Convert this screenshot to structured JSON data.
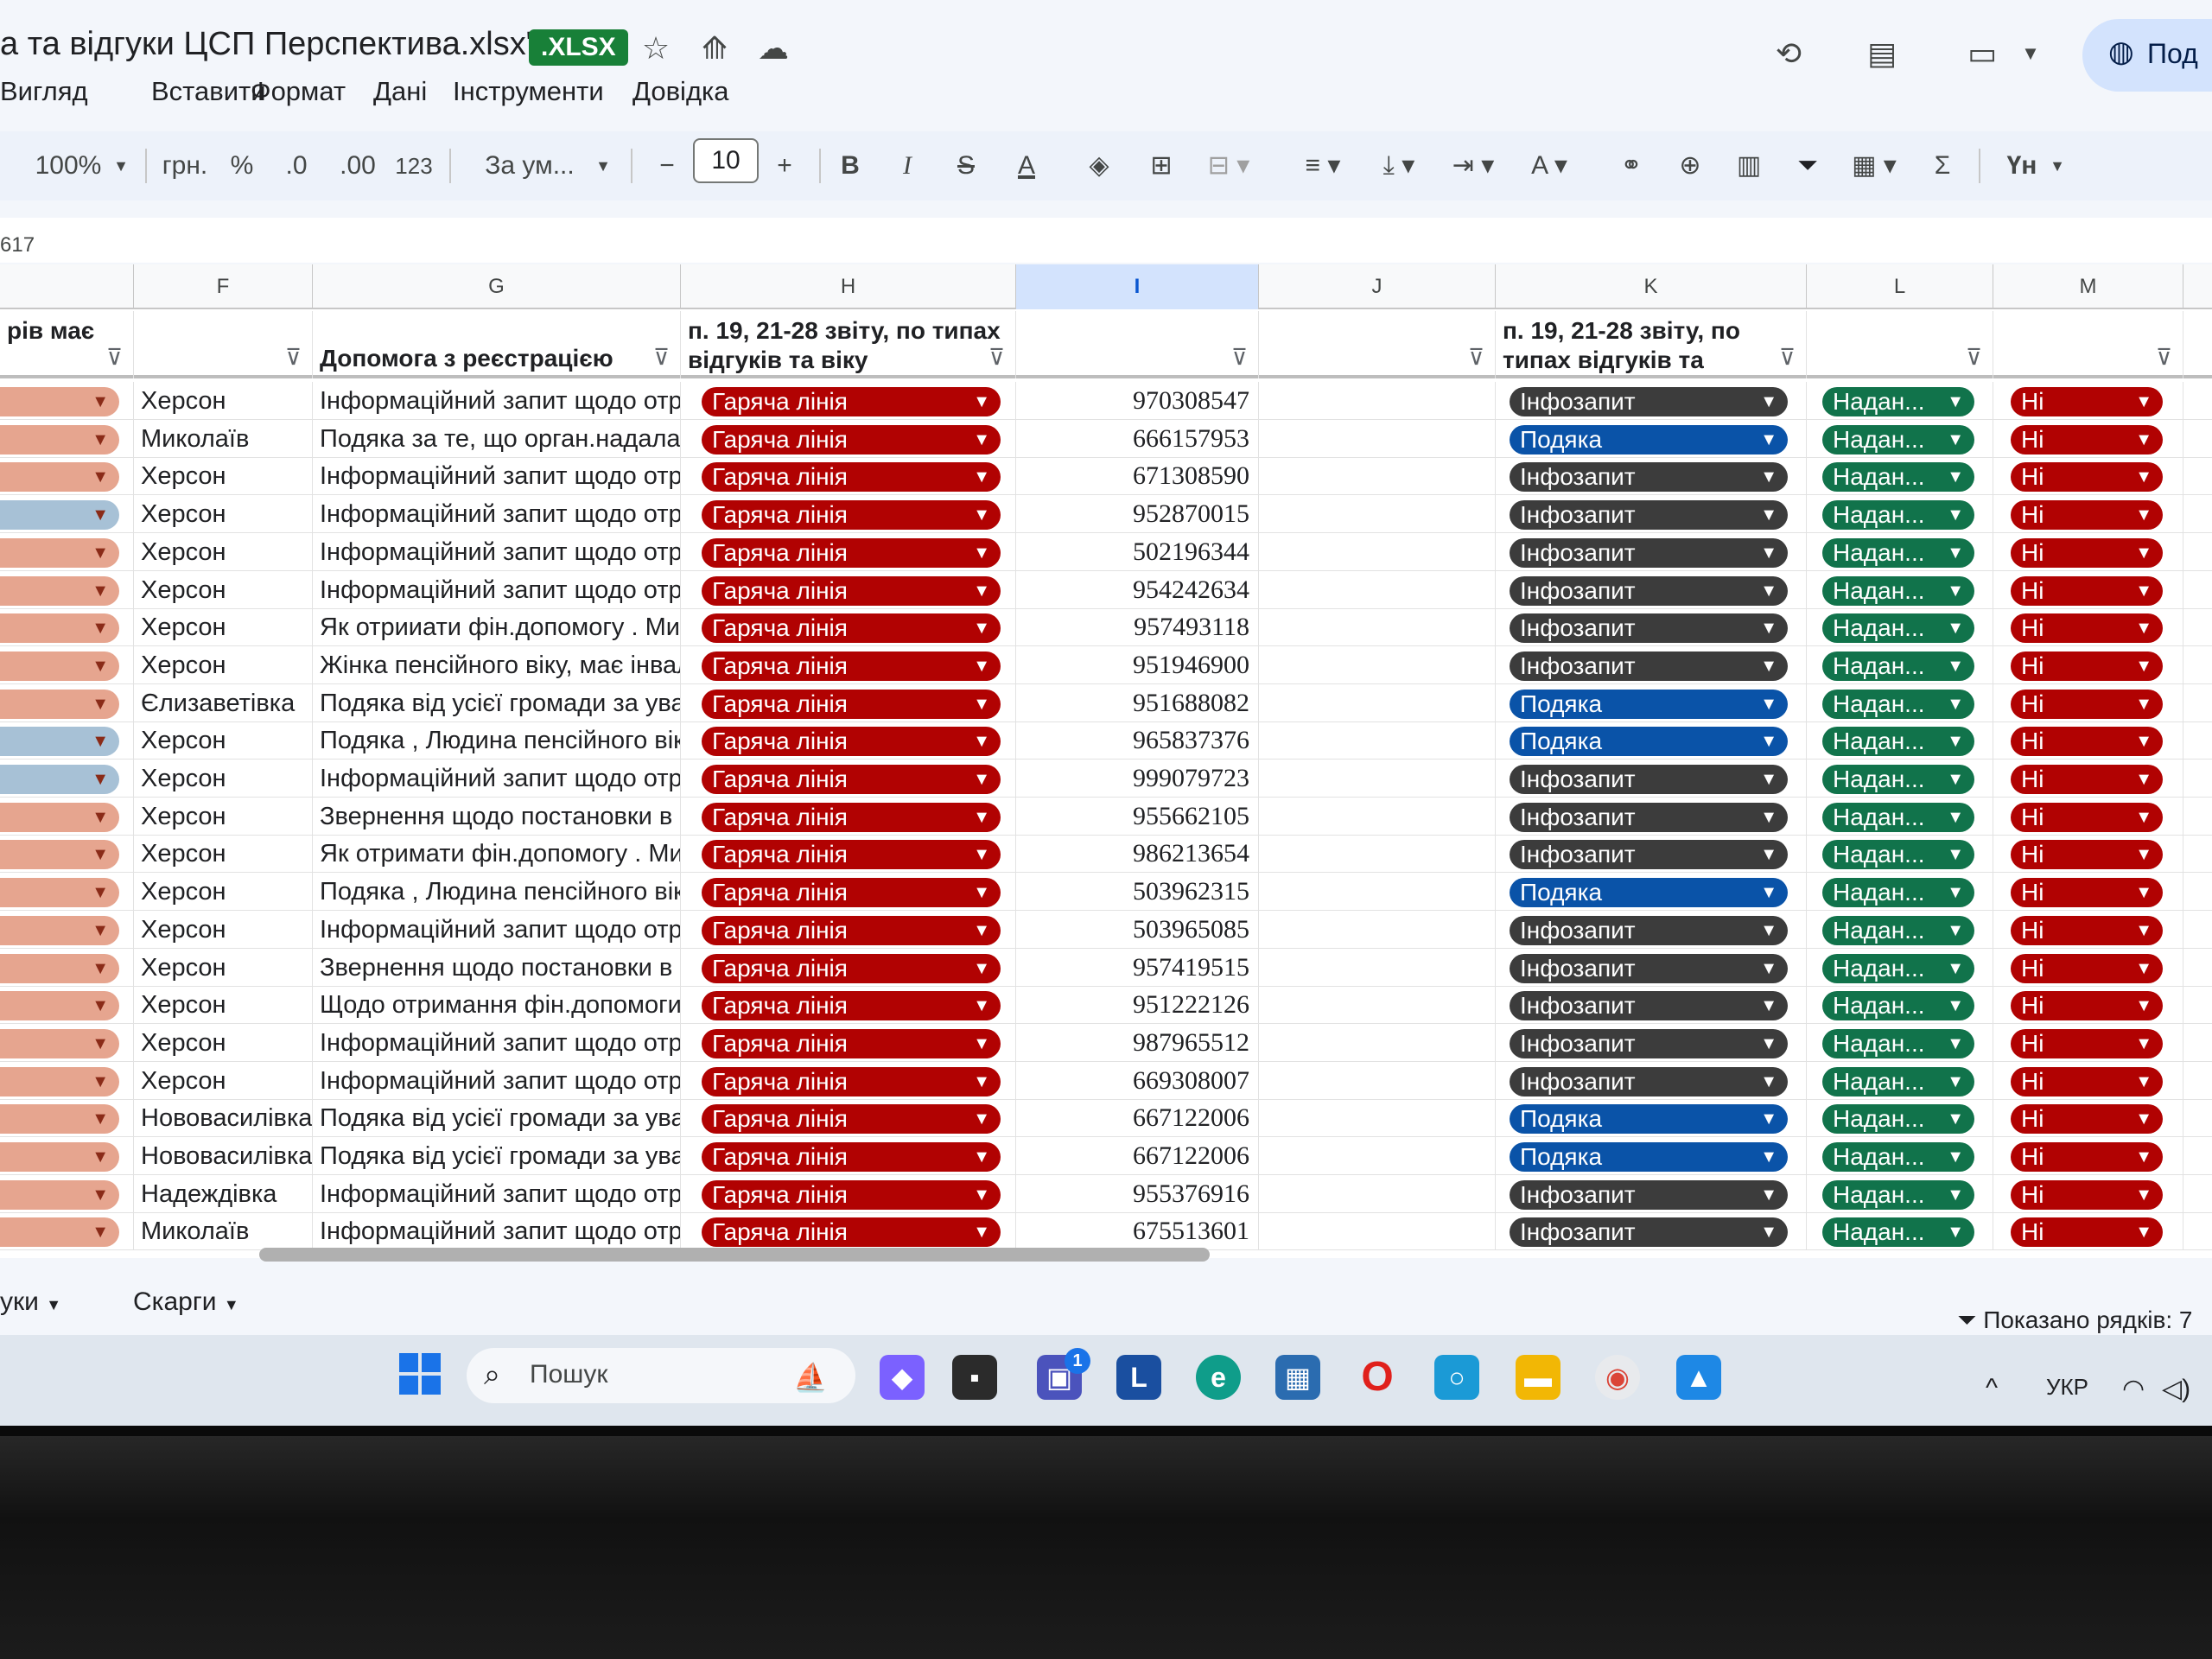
{
  "doc": {
    "title": "а та відгуки ЦСП Перспектива.xlsx\"",
    "badge": ".XLSX",
    "share_label": "Под"
  },
  "menu": [
    "Вигляд",
    "Вставити",
    "Формат",
    "Дані",
    "Інструменти",
    "Довідка"
  ],
  "toolbar": {
    "zoom": "100%",
    "currency": "грн.",
    "percent": "%",
    "dec_dec": ".0",
    "dec_inc": ".00",
    "num_fmt": "123",
    "font": "За ум...",
    "font_size": "10",
    "sigma": "Σ",
    "language": "Үн"
  },
  "cell_ref": "617",
  "columns": [
    "F",
    "G",
    "H",
    "I",
    "J",
    "K",
    "L",
    "M"
  ],
  "headers": {
    "e": "рів має",
    "f": "",
    "g": "Допомога з реєстрацією",
    "h": "п. 19, 21-28 звіту, по типах відгуків та віку",
    "i": "",
    "j": "",
    "k": "п. 19, 21-28 звіту, по типах відгуків та",
    "l": "",
    "m": ""
  },
  "rows": [
    {
      "e": "salmon",
      "f": "Херсон",
      "g": "Інформаційний запит щодо отри",
      "h": "Гаряча лінія",
      "i": "970308547",
      "k": "Інфозапит",
      "l": "Надан...",
      "m": "Ні"
    },
    {
      "e": "salmon",
      "f": "Миколаїв",
      "g": "Подяка за те, що орган.надала д",
      "h": "Гаряча лінія",
      "i": "666157953",
      "k": "Подяка",
      "l": "Надан...",
      "m": "Ні"
    },
    {
      "e": "salmon",
      "f": "Херсон",
      "g": "Інформаційний запит щодо отри",
      "h": "Гаряча лінія",
      "i": "671308590",
      "k": "Інфозапит",
      "l": "Надан...",
      "m": "Ні"
    },
    {
      "e": "steel",
      "f": "Херсон",
      "g": "Інформаційний запит щодо отри",
      "h": "Гаряча лінія",
      "i": "952870015",
      "k": "Інфозапит",
      "l": "Надан...",
      "m": "Ні"
    },
    {
      "e": "salmon",
      "f": "Херсон",
      "g": "Інформаційний запит щодо отри",
      "h": "Гаряча лінія",
      "i": "502196344",
      "k": "Інфозапит",
      "l": "Надан...",
      "m": "Ні"
    },
    {
      "e": "salmon",
      "f": "Херсон",
      "g": "Інформаційний запит щодо отри",
      "h": "Гаряча лінія",
      "i": "954242634",
      "k": "Інфозапит",
      "l": "Надан...",
      "m": "Ні"
    },
    {
      "e": "salmon",
      "f": "Херсон",
      "g": "Як отрииати фін.допомогу . Ми з",
      "h": "Гаряча лінія",
      "i": "957493118",
      "k": "Інфозапит",
      "l": "Надан...",
      "m": "Ні"
    },
    {
      "e": "salmon",
      "f": "Херсон",
      "g": "Жінка пенсійного  віку, має інвалі",
      "h": "Гаряча лінія",
      "i": "951946900",
      "k": "Інфозапит",
      "l": "Надан...",
      "m": "Ні"
    },
    {
      "e": "salmon",
      "f": "Єлизаветівка",
      "g": "Подяка від усієї громади за уваж",
      "h": "Гаряча лінія",
      "i": "951688082",
      "k": "Подяка",
      "l": "Надан...",
      "m": "Ні"
    },
    {
      "e": "steel",
      "f": "Херсон",
      "g": "Подяка , Людина пенсійного віку",
      "h": "Гаряча лінія",
      "i": "965837376",
      "k": "Подяка",
      "l": "Надан...",
      "m": "Ні"
    },
    {
      "e": "steel",
      "f": "Херсон",
      "g": "Інформаційний запит щодо отри",
      "h": "Гаряча лінія",
      "i": "999079723",
      "k": "Інфозапит",
      "l": "Надан...",
      "m": "Ні"
    },
    {
      "e": "salmon",
      "f": "Херсон",
      "g": "Звернення щодо постановки в че",
      "h": "Гаряча лінія",
      "i": "955662105",
      "k": "Інфозапит",
      "l": "Надан...",
      "m": "Ні"
    },
    {
      "e": "salmon",
      "f": "Херсон",
      "g": "Як отримати фін.допомогу . Ми з",
      "h": "Гаряча лінія",
      "i": "986213654",
      "k": "Інфозапит",
      "l": "Надан...",
      "m": "Ні"
    },
    {
      "e": "salmon",
      "f": "Херсон",
      "g": "Подяка , Людина пенсійного віку",
      "h": "Гаряча лінія",
      "i": "503962315",
      "k": "Подяка",
      "l": "Надан...",
      "m": "Ні"
    },
    {
      "e": "salmon",
      "f": "Херсон",
      "g": "Інформаційний запит щодо отри",
      "h": "Гаряча лінія",
      "i": "503965085",
      "k": "Інфозапит",
      "l": "Надан...",
      "m": "Ні"
    },
    {
      "e": "salmon",
      "f": "Херсон",
      "g": "Звернення щодо постановки в че",
      "h": "Гаряча лінія",
      "i": "957419515",
      "k": "Інфозапит",
      "l": "Надан...",
      "m": "Ні"
    },
    {
      "e": "salmon",
      "f": "Херсон",
      "g": "Щодо отримання фін.допомоги в",
      "h": "Гаряча лінія",
      "i": "951222126",
      "k": "Інфозапит",
      "l": "Надан...",
      "m": "Ні"
    },
    {
      "e": "salmon",
      "f": "Херсон",
      "g": "Інформаційний запит щодо отри",
      "h": "Гаряча лінія",
      "i": "987965512",
      "k": "Інфозапит",
      "l": "Надан...",
      "m": "Ні"
    },
    {
      "e": "salmon",
      "f": "Херсон",
      "g": "Інформаційний запит щодо отри",
      "h": "Гаряча лінія",
      "i": "669308007",
      "k": "Інфозапит",
      "l": "Надан...",
      "m": "Ні"
    },
    {
      "e": "salmon",
      "f": "Нововасилівка",
      "g": "Подяка від усієї громади за уваж",
      "h": "Гаряча лінія",
      "i": "667122006",
      "k": "Подяка",
      "l": "Надан...",
      "m": "Ні"
    },
    {
      "e": "salmon",
      "f": "Нововасилівка",
      "g": "Подяка від усієї громади за уваж",
      "h": "Гаряча лінія",
      "i": "667122006",
      "k": "Подяка",
      "l": "Надан...",
      "m": "Ні"
    },
    {
      "e": "salmon",
      "f": "Надеждівка",
      "g": "Інформаційний запит щодо отри",
      "h": "Гаряча лінія",
      "i": "955376916",
      "k": "Інфозапит",
      "l": "Надан...",
      "m": "Ні"
    },
    {
      "e": "salmon",
      "f": "Миколаїв",
      "g": "Інформаційний запит щодо отри",
      "h": "Гаряча лінія",
      "i": "675513601",
      "k": "Інфозапит",
      "l": "Надан...",
      "m": "Ні"
    }
  ],
  "sheets": [
    "уки",
    "Скарги"
  ],
  "rows_shown": "Показано рядків: 7",
  "taskbar": {
    "search_label": "Пошук",
    "lang": "УКР",
    "teams_badge": "1"
  },
  "colors": {
    "hot_line": "#b10202",
    "info": "#3c3c3c",
    "thanks": "#0a53a8",
    "provided": "#11734b",
    "no": "#b10202",
    "xlsx_badge": "#188038"
  }
}
